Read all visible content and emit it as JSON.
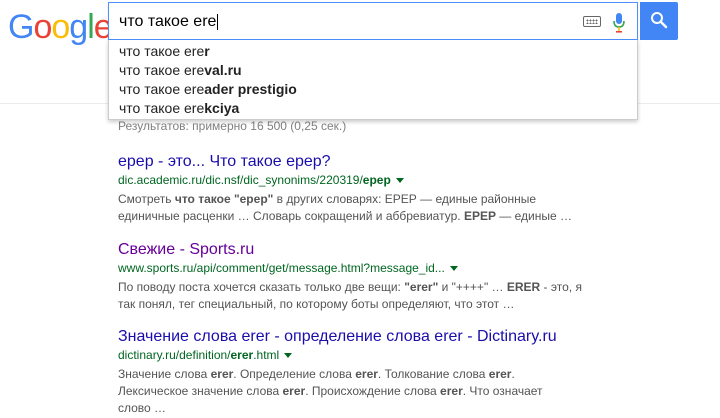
{
  "logo": "Google",
  "search": {
    "query": "что такое ere"
  },
  "suggestions": [
    {
      "prefix": "что такое ere",
      "suffix": "r"
    },
    {
      "prefix": "что такое ere",
      "suffix": "val.ru"
    },
    {
      "prefix": "что такое ere",
      "suffix": "ader prestigio"
    },
    {
      "prefix": "что такое ere",
      "suffix": "kciya"
    }
  ],
  "stats": "Результатов: примерно 16 500 (0,25 сек.)",
  "results": [
    {
      "title": "ерер - это... Что такое ерер?",
      "url_prefix": "dic.academic.ru/dic.nsf/dic_synonims/220319/",
      "url_bold": "ерер",
      "snippet_lines": [
        {
          "parts": [
            {
              "t": "Смотреть ",
              "b": false
            },
            {
              "t": "что такое \"ерер\"",
              "b": true
            },
            {
              "t": " в других словарях: ЕРЕР — единые районные",
              "b": false
            }
          ]
        },
        {
          "parts": [
            {
              "t": "единичные расценки … Словарь сокращений и аббревиатур. ",
              "b": false
            },
            {
              "t": "ЕРЕР",
              "b": true
            },
            {
              "t": " — единые …",
              "b": false
            }
          ]
        }
      ]
    },
    {
      "title": "Свежие - Sports.ru",
      "url_prefix": "www.sports.ru/api/comment/get/message.html?message_id...",
      "url_bold": "",
      "snippet_lines": [
        {
          "parts": [
            {
              "t": "По поводу поста хочется сказать только две вещи: ",
              "b": false
            },
            {
              "t": "\"erer\"",
              "b": true
            },
            {
              "t": " и \"++++\" … ",
              "b": false
            },
            {
              "t": "ERER",
              "b": true
            },
            {
              "t": " - это, я",
              "b": false
            }
          ]
        },
        {
          "parts": [
            {
              "t": "так понял, тег специальный, по которому боты определяют, что этот …",
              "b": false
            }
          ]
        }
      ]
    },
    {
      "title": "Значение слова erer - определение слова erer - Dictinary.ru",
      "url_prefix": "dictinary.ru/definition/",
      "url_bold": "erer",
      "url_suffix": ".html",
      "snippet_lines": [
        {
          "parts": [
            {
              "t": "Значение слова ",
              "b": false
            },
            {
              "t": "erer",
              "b": true
            },
            {
              "t": ". Определение слова ",
              "b": false
            },
            {
              "t": "erer",
              "b": true
            },
            {
              "t": ". Толкование слова ",
              "b": false
            },
            {
              "t": "erer",
              "b": true
            },
            {
              "t": ".",
              "b": false
            }
          ]
        },
        {
          "parts": [
            {
              "t": "Лексическое значение слова ",
              "b": false
            },
            {
              "t": "erer",
              "b": true
            },
            {
              "t": ". Происхождение слова ",
              "b": false
            },
            {
              "t": "erer",
              "b": true
            },
            {
              "t": ". Что означает",
              "b": false
            }
          ]
        },
        {
          "parts": [
            {
              "t": "слово …",
              "b": false
            }
          ]
        }
      ]
    }
  ],
  "colors": {
    "accent": "#4285f4",
    "link": "#1a0dab",
    "visited": "#660099",
    "url": "#006621",
    "snippet": "#545454"
  }
}
